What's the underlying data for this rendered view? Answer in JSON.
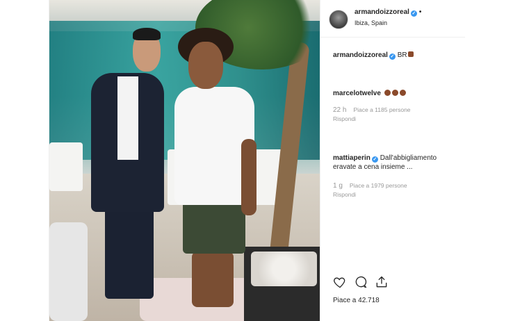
{
  "post": {
    "author": "armandoizzoreal",
    "location": "Ibiza, Spain",
    "follow_dot": "•",
    "caption": {
      "user": "armandoizzoreal",
      "text": "BR"
    }
  },
  "comments": [
    {
      "user": "marcelotwelve",
      "verified": false,
      "text": "",
      "time": "22 h",
      "likes": "Piace a 1185 persone",
      "reply": "Rispondi"
    },
    {
      "user": "mattiaperin",
      "verified": true,
      "text": "Dall'abbigliamento eravate a cena insieme ...",
      "time": "1 g",
      "likes": "Piace a 1979 persone",
      "reply": "Rispondi"
    }
  ],
  "likes_label": "Piace a 42.718",
  "icons": [
    "heart-icon",
    "comment-icon",
    "share-icon",
    "verified-badge-icon",
    "boxing-glove-emoji-icon"
  ],
  "colors": {
    "verified": "#3897f0",
    "text": "#262626",
    "meta": "#999999",
    "border": "#efefef"
  }
}
